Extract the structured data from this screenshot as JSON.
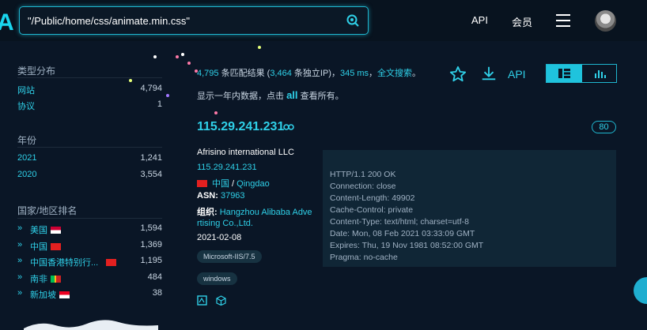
{
  "header": {
    "logo": "A",
    "search_value": "\"/Public/home/css/animate.min.css\"",
    "nav_api": "API",
    "nav_member": "会员"
  },
  "sidebar": {
    "type_title": "类型分布",
    "types": [
      {
        "label": "网站",
        "count": "4,794"
      },
      {
        "label": "协议",
        "count": "1"
      }
    ],
    "year_title": "年份",
    "years": [
      {
        "label": "2021",
        "count": "1,241"
      },
      {
        "label": "2020",
        "count": "3,554"
      }
    ],
    "country_title": "国家/地区排名",
    "countries": [
      {
        "label": "美国",
        "count": "1,594"
      },
      {
        "label": "中国",
        "count": "1,369"
      },
      {
        "label": "中国香港特别行...",
        "count": "1,195"
      },
      {
        "label": "南非",
        "count": "484"
      },
      {
        "label": "新加坡",
        "count": "38"
      }
    ]
  },
  "results": {
    "count": "4,795",
    "count_suffix": " 条匹配结果 (",
    "unique": "3,464",
    "unique_suffix": " 条独立IP)，",
    "time": "345 ms",
    "time_suffix": "，",
    "fulltext": "全文搜索",
    "fulltext_suffix": "。",
    "note_prefix": "显示一年内数据，点击 ",
    "note_all": "all",
    "note_suffix": " 查看所有。",
    "api_label": "API"
  },
  "card": {
    "ip": "115.29.241.231",
    "port": "80",
    "org": "Afrisino international LLC",
    "ip_link": "115.29.241.231",
    "country": "中国",
    "separator": " / ",
    "city": "Qingdao",
    "asn_label": "ASN: ",
    "asn": "37963",
    "org_label": "组织: ",
    "org_name_line1": "Hangzhou Alibaba Adve",
    "org_name_line2": "rtising Co.,Ltd.",
    "date": "2021-02-08",
    "tags": [
      "Microsoft-IIS/7.5",
      "windows"
    ]
  },
  "banner_lines": [
    "HTTP/1.1 200 OK",
    "Connection: close",
    "Content-Length: 49902",
    "Cache-Control: private",
    "Content-Type: text/html; charset=utf-8",
    "Date: Mon, 08 Feb 2021 03:33:09 GMT",
    "Expires: Thu, 19 Nov 1981 08:52:00 GMT",
    "Pragma: no-cache"
  ],
  "colors": {
    "accent": "#2fd0e8",
    "background": "#0a1626",
    "panel": "#102636"
  }
}
